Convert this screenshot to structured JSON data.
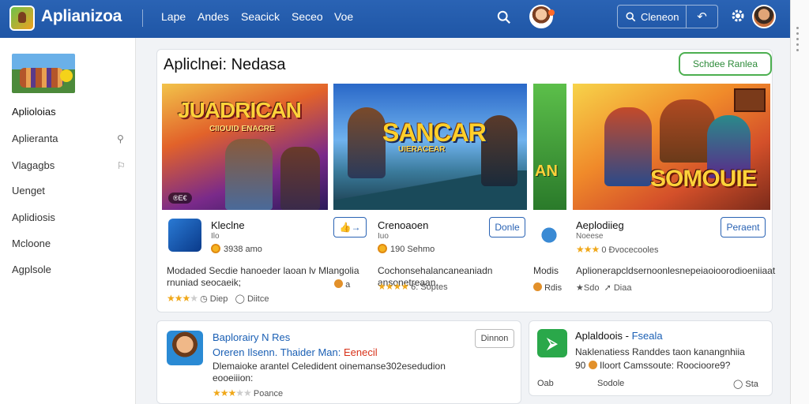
{
  "header": {
    "app_title": "Aplianizoa",
    "app_subtitle": "",
    "nav": [
      "Lape",
      "Andes",
      "Seacick",
      "Seceo",
      "Voe"
    ],
    "search_label": "Cleneon",
    "nav_arrow": "↶"
  },
  "sidebar": {
    "items": [
      {
        "label": "Aplioloias"
      },
      {
        "label": "Aplieranta"
      },
      {
        "label": "Vlagagbs"
      },
      {
        "label": "Uenget"
      },
      {
        "label": "Aplidiosis"
      },
      {
        "label": "Mcloone"
      },
      {
        "label": "Agplsole"
      }
    ]
  },
  "featured": {
    "title": "Apliclnei: Nedasa",
    "action_label": "Schdee Ranlea",
    "banners": [
      {
        "title": "JUADRICAN",
        "subtitle": "CIIOUID ENACRE",
        "tag": "®E€"
      },
      {
        "title": "SANCAR",
        "subtitle": "UIERACEAR"
      },
      {
        "title": "AN"
      },
      {
        "title": "SOMOUIE"
      }
    ],
    "apps": [
      {
        "name": "Kleclne",
        "dev": "Ilo",
        "coins": "3938 amo",
        "blurb": "Modaded Secdie hanoeder laoan lv Mlangolia rnuniad seocaeik;",
        "stars": "★★★",
        "rating_a": "Diep",
        "rating_b": "Diitce",
        "button": "👍→",
        "reaction": "a"
      },
      {
        "name": "Crenoaoen",
        "dev": "Iuo",
        "coins": "190 Sehmo",
        "blurb": "Cochonsehalancaneaniadn ansonetreaan",
        "stars": "★★★★",
        "rating_a": "6: Soptes",
        "button": "Donle"
      },
      {
        "name": "Aeplodiieg",
        "dev": "Noeese",
        "rating_a": "0 Đvocecooles",
        "blurb": "Aplionerapcldsernoonlesnepeiaoioorodioeniiaat",
        "stars": "★★★",
        "rating_b": "★Sdo",
        "rating_c": "Diaa",
        "button": "Peraent",
        "side_label": "Modis",
        "side_label2": "Rdis"
      }
    ]
  },
  "bottom_left": {
    "title": "Baplorairy N Res",
    "line2_a": "Oreren Ilsenn.  Thaider Man:",
    "line2_b": "Eenecil",
    "blurb": "Dlemaioke arantel Celedident oinemanse302esedudion eooeiiion:",
    "stars": "★★★",
    "rating": "Poance",
    "button": "Dinnon"
  },
  "bottom_right": {
    "title_a": "Aplaldoois -",
    "title_b": "Fseala",
    "blurb1": "Naklenatiess Randdes taon kanangnhiia",
    "blurb2": "90",
    "blurb3": "Iloort Camssoute: Roocioore9?",
    "footer_a": "Oab",
    "footer_b": "Sodole",
    "footer_c": "Sta"
  },
  "colors": {
    "brand": "#2a63b4",
    "accent_green": "#4caf50",
    "star": "#f0a81a"
  }
}
